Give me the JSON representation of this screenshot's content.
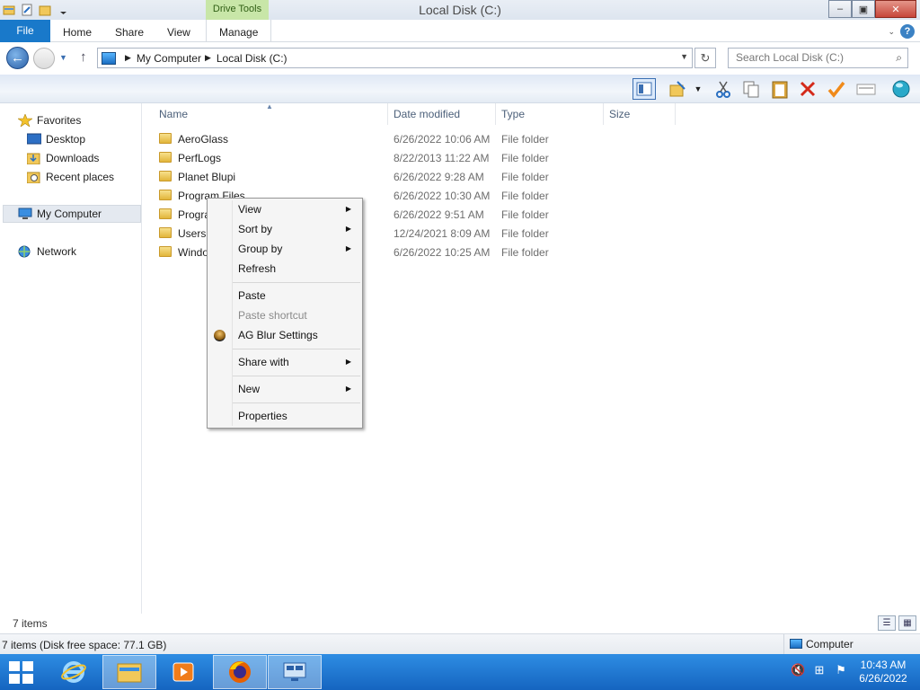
{
  "window": {
    "title": "Local Disk (C:)",
    "context_tab": "Drive Tools",
    "controls": {
      "minimize": "–",
      "restore": "▣",
      "close": "✕"
    }
  },
  "ribbon": {
    "tabs": [
      "File",
      "Home",
      "Share",
      "View",
      "Manage"
    ],
    "help": "?"
  },
  "address": {
    "crumbs": [
      "My Computer",
      "Local Disk (C:)"
    ],
    "search_placeholder": "Search Local Disk (C:)"
  },
  "toolbar": {
    "icons": [
      "preview-pane-icon",
      "new-folder-icon",
      "cut-icon",
      "copy-icon",
      "paste-icon",
      "delete-icon",
      "rename-icon",
      "properties-icon",
      "ag-sphere-icon"
    ]
  },
  "nav": {
    "favorites": "Favorites",
    "favorite_items": [
      "Desktop",
      "Downloads",
      "Recent places"
    ],
    "computer": "My Computer",
    "network": "Network"
  },
  "columns": [
    "Name",
    "Date modified",
    "Type",
    "Size"
  ],
  "files": [
    {
      "name": "AeroGlass",
      "date": "6/26/2022 10:06 AM",
      "type": "File folder"
    },
    {
      "name": "PerfLogs",
      "date": "8/22/2013 11:22 AM",
      "type": "File folder"
    },
    {
      "name": "Planet Blupi",
      "date": "6/26/2022 9:28 AM",
      "type": "File folder"
    },
    {
      "name": "Program Files",
      "date": "6/26/2022 10:30 AM",
      "type": "File folder"
    },
    {
      "name": "Progra",
      "date": "6/26/2022 9:51 AM",
      "type": "File folder"
    },
    {
      "name": "Users",
      "date": "12/24/2021 8:09 AM",
      "type": "File folder"
    },
    {
      "name": "Windo",
      "date": "6/26/2022 10:25 AM",
      "type": "File folder"
    }
  ],
  "context_menu": {
    "view": "View",
    "sort_by": "Sort by",
    "group_by": "Group by",
    "refresh": "Refresh",
    "paste": "Paste",
    "paste_shortcut": "Paste shortcut",
    "ag_blur": "AG Blur Settings",
    "share_with": "Share with",
    "new": "New",
    "properties": "Properties"
  },
  "status": {
    "count": "7 items",
    "details": "7 items (Disk free space: 77.1 GB)",
    "zone": "Computer"
  },
  "taskbar": {
    "time": "10:43 AM",
    "date": "6/26/2022"
  }
}
